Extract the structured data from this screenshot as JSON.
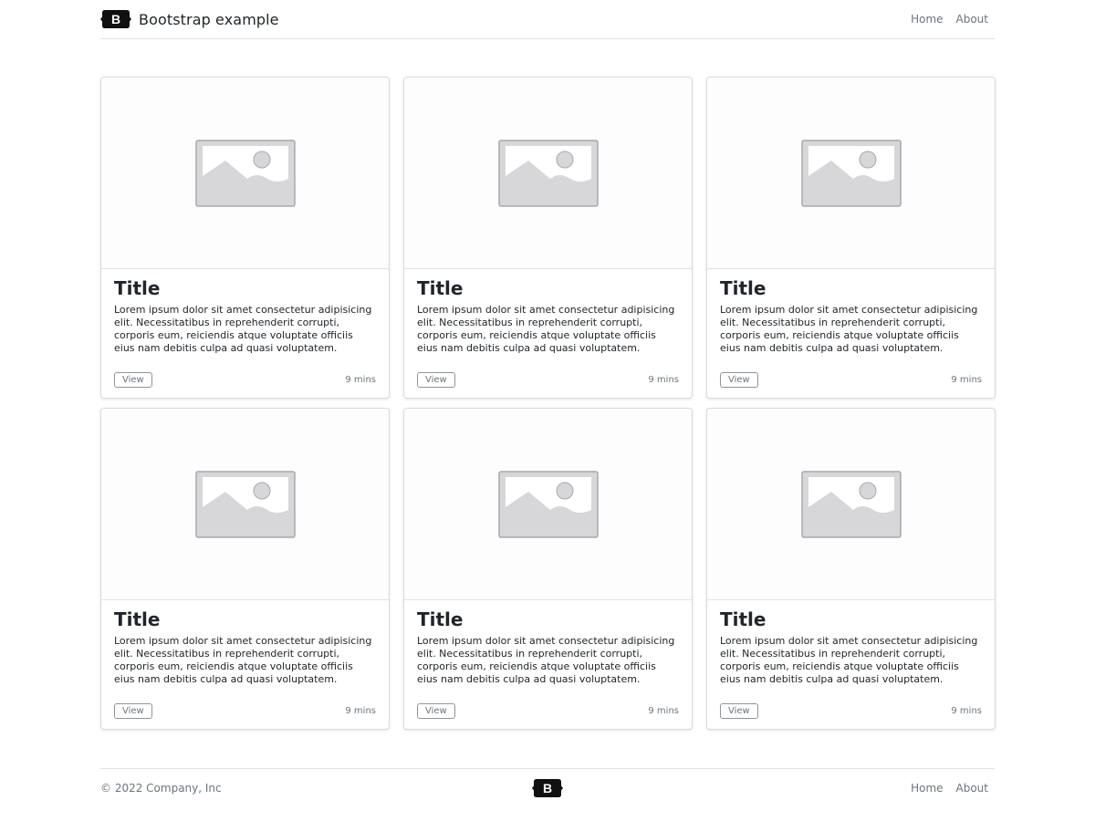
{
  "header": {
    "brand_text": "Bootstrap example",
    "logo_letter": "B",
    "nav": [
      "Home",
      "About"
    ]
  },
  "cards": [
    {
      "title": "Title",
      "text": "Lorem ipsum dolor sit amet consectetur adipisicing elit. Necessitatibus in reprehenderit corrupti, corporis eum, reiciendis atque voluptate officiis eius nam debitis culpa ad quasi voluptatem.",
      "button": "View",
      "time": "9 mins"
    },
    {
      "title": "Title",
      "text": "Lorem ipsum dolor sit amet consectetur adipisicing elit. Necessitatibus in reprehenderit corrupti, corporis eum, reiciendis atque voluptate officiis eius nam debitis culpa ad quasi voluptatem.",
      "button": "View",
      "time": "9 mins"
    },
    {
      "title": "Title",
      "text": "Lorem ipsum dolor sit amet consectetur adipisicing elit. Necessitatibus in reprehenderit corrupti, corporis eum, reiciendis atque voluptate officiis eius nam debitis culpa ad quasi voluptatem.",
      "button": "View",
      "time": "9 mins"
    },
    {
      "title": "Title",
      "text": "Lorem ipsum dolor sit amet consectetur adipisicing elit. Necessitatibus in reprehenderit corrupti, corporis eum, reiciendis atque voluptate officiis eius nam debitis culpa ad quasi voluptatem.",
      "button": "View",
      "time": "9 mins"
    },
    {
      "title": "Title",
      "text": "Lorem ipsum dolor sit amet consectetur adipisicing elit. Necessitatibus in reprehenderit corrupti, corporis eum, reiciendis atque voluptate officiis eius nam debitis culpa ad quasi voluptatem.",
      "button": "View",
      "time": "9 mins"
    },
    {
      "title": "Title",
      "text": "Lorem ipsum dolor sit amet consectetur adipisicing elit. Necessitatibus in reprehenderit corrupti, corporis eum, reiciendis atque voluptate officiis eius nam debitis culpa ad quasi voluptatem.",
      "button": "View",
      "time": "9 mins"
    }
  ],
  "footer": {
    "copyright": "© 2022 Company, Inc",
    "logo_letter": "B",
    "nav": [
      "Home",
      "About"
    ]
  },
  "icons": {
    "brand": "bootstrap-logo-icon",
    "placeholder": "image-placeholder-icon"
  }
}
